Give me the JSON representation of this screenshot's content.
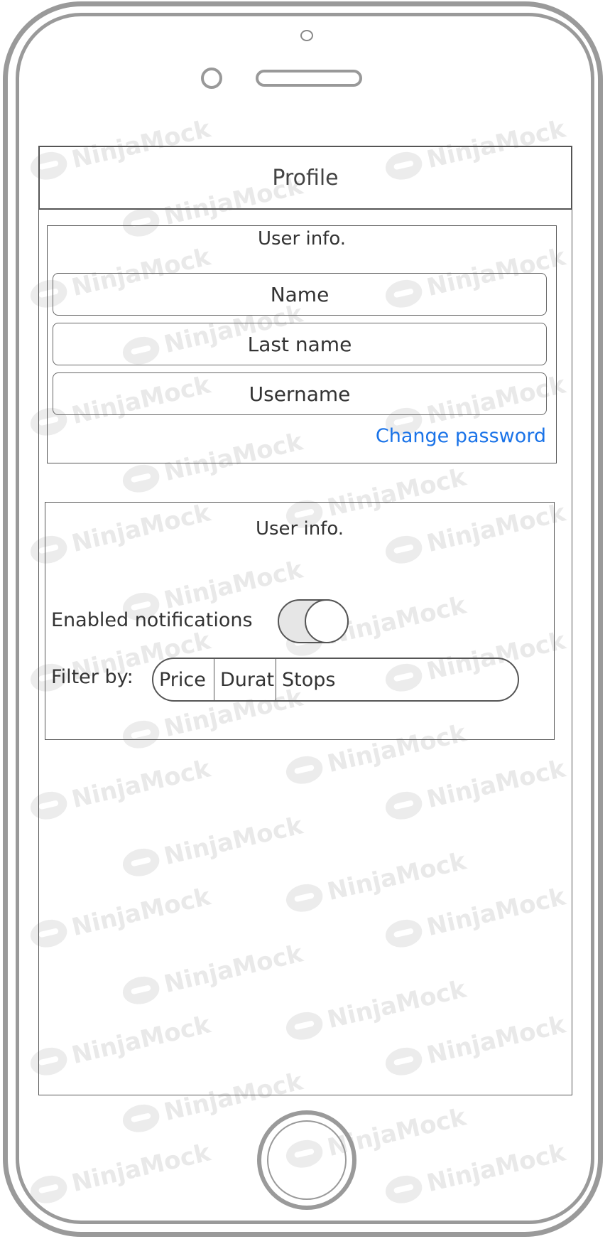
{
  "header": {
    "title": "Profile"
  },
  "user_info_panel": {
    "title": "User info.",
    "fields": [
      {
        "label": "Name"
      },
      {
        "label": "Last name"
      },
      {
        "label": "Username"
      }
    ],
    "change_password_label": "Change password"
  },
  "settings_panel": {
    "title": "User info.",
    "notifications_label": "Enabled notifications",
    "notifications_enabled": true,
    "filter_label": "Filter by:",
    "filter_options": [
      "Price",
      "Duration",
      "Stops"
    ]
  },
  "watermark_text": "NinjaMock",
  "colors": {
    "link": "#1a73e8",
    "frame": "#9a9a9a",
    "toggle_track": "#e6e6e6"
  }
}
